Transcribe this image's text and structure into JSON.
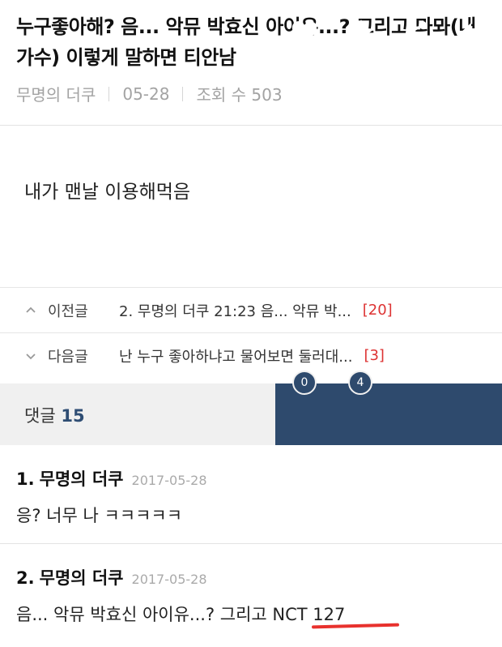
{
  "post": {
    "title": "누구좋아해? 음... 악뮤 박효신 아이유...? 그리고 뫄뫄(내가수) 이렇게 말하면 티안남",
    "author": "무명의 더쿠",
    "date": "05-28",
    "views": "조회 수 503",
    "body": "내가 맨날 이용해먹음"
  },
  "navigation": {
    "prev": {
      "label": "이전글",
      "text": "2. 무명의 더쿠 21:23 음... 악뮤 박...",
      "count": "[20]"
    },
    "next": {
      "label": "다음글",
      "text": "난 누구 좋아하냐고 물어보면 둘러대...",
      "count": "[3]"
    }
  },
  "action_bar": {
    "comment_label": "댓글",
    "comment_count": "15",
    "like_count": "0",
    "scrap_count": "4",
    "colors": {
      "panel": "#2e4a6d",
      "accent": "#2e4d73",
      "highlight": "#e8312d"
    },
    "icons": [
      "heart-icon",
      "star-icon",
      "share-icon",
      "back-arrow-icon"
    ]
  },
  "comments": [
    {
      "number": "1.",
      "author": "무명의 더쿠",
      "date": "2017-05-28",
      "body": "응? 너무 나 ㅋㅋㅋㅋㅋ"
    },
    {
      "number": "2.",
      "author": "무명의 더쿠",
      "date": "2017-05-28",
      "body": "음... 악뮤 박효신 아이유...? 그리고 NCT 127"
    }
  ]
}
